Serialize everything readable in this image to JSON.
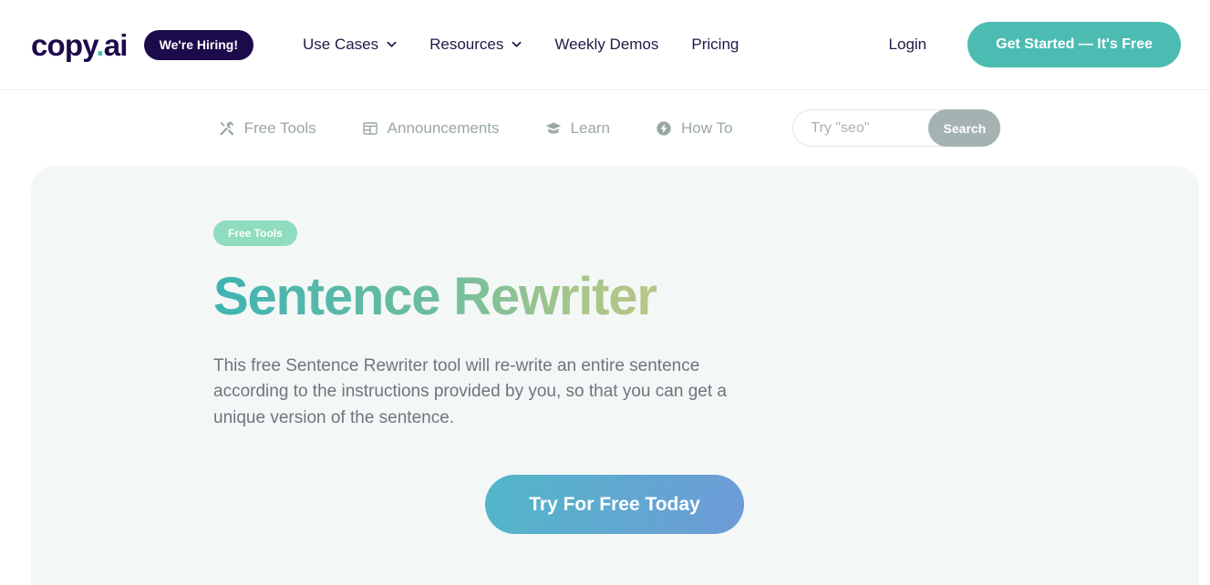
{
  "brand": {
    "name_main": "copy",
    "name_dot": ".",
    "name_suffix": "ai",
    "hiring_label": "We're Hiring!",
    "accent_color": "#49c3bb",
    "dark_color": "#1b0b4b"
  },
  "header": {
    "nav": [
      {
        "label": "Use Cases",
        "has_caret": true
      },
      {
        "label": "Resources",
        "has_caret": true
      },
      {
        "label": "Weekly Demos",
        "has_caret": false
      },
      {
        "label": "Pricing",
        "has_caret": false
      }
    ],
    "login_label": "Login",
    "cta_label": "Get Started — It's Free",
    "cta_color": "#4cbcb2"
  },
  "subnav": {
    "items": [
      {
        "label": "Free Tools",
        "icon": "tools-icon"
      },
      {
        "label": "Announcements",
        "icon": "announcements-icon"
      },
      {
        "label": "Learn",
        "icon": "graduation-cap-icon"
      },
      {
        "label": "How To",
        "icon": "lightning-circle-icon"
      }
    ],
    "search": {
      "placeholder": "Try \"seo\"",
      "value": "",
      "button_label": "Search"
    }
  },
  "hero": {
    "badge_label": "Free Tools",
    "badge_color": "#8fdcbe",
    "title": "Sentence Rewriter",
    "title_gradient_start": "#3fb3b3",
    "title_gradient_end": "#d6c97e",
    "description": "This free Sentence Rewriter tool will re-write an entire sentence according to the instructions provided by you, so that you can get a unique version of the sentence.",
    "cta_label": "Try For Free Today",
    "cta_gradient_start": "#52b6c8",
    "cta_gradient_end": "#6e9bd8",
    "panel_background": "#f3f7f6"
  }
}
